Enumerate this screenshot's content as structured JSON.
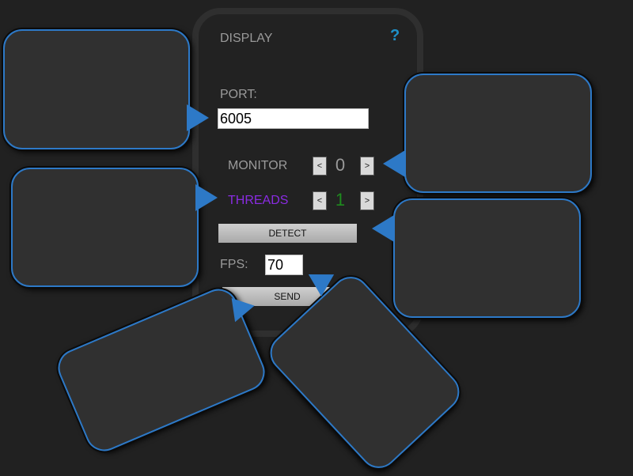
{
  "panel": {
    "title": "DISPLAY",
    "help_label": "?",
    "port": {
      "label": "PORT:",
      "value": "6005"
    },
    "monitor": {
      "label": "MONITOR",
      "value": "0",
      "dec_label": "<",
      "inc_label": ">"
    },
    "threads": {
      "label": "THREADS",
      "value": "1",
      "dec_label": "<",
      "inc_label": ">"
    },
    "detect_label": "DETECT",
    "fps": {
      "label": "FPS:",
      "value": "70"
    },
    "send_label": "SEND"
  },
  "colors": {
    "background": "#212121",
    "bubble_fill": "#303030",
    "bubble_border": "#2d79c7",
    "threads_label": "#8a2be2",
    "threads_value": "#1e8c1e",
    "help": "#1e90c8"
  }
}
